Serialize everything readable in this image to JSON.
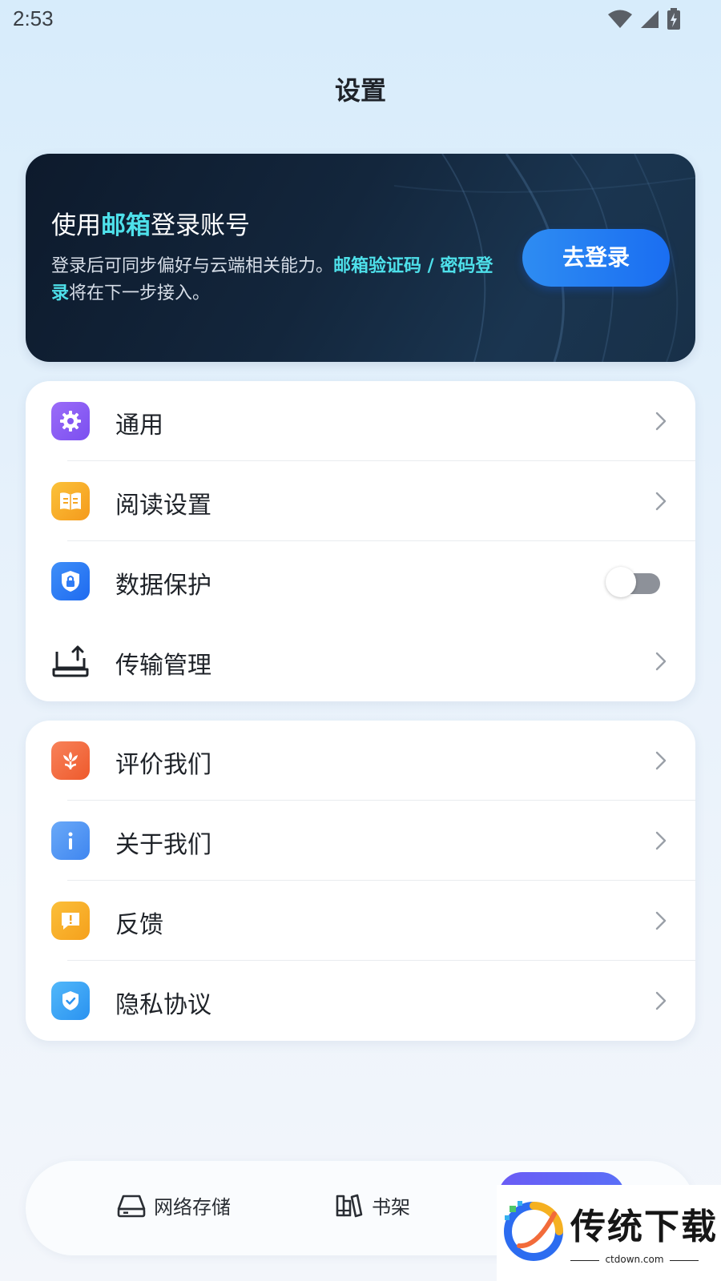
{
  "status_bar": {
    "time": "2:53"
  },
  "header": {
    "title": "设置"
  },
  "login_banner": {
    "heading_prefix": "使用",
    "heading_highlight": "邮箱",
    "heading_suffix": "登录账号",
    "desc_plain_1": "登录后可同步偏好与云端相关能力。",
    "desc_highlight": "邮箱验证码 / 密码登录",
    "desc_plain_2": "将在下一步接入。",
    "button_label": "去登录"
  },
  "settings_group_1": {
    "items": [
      {
        "label": "通用",
        "icon": "gear-icon",
        "color": "#8b5cf6"
      },
      {
        "label": "阅读设置",
        "icon": "book-icon",
        "color": "#f5a623"
      },
      {
        "label": "数据保护",
        "icon": "shield-lock-icon",
        "color": "#2f7cf6",
        "toggle_on": false
      },
      {
        "label": "传输管理",
        "icon": "laptop-upload-icon"
      }
    ]
  },
  "settings_group_2": {
    "items": [
      {
        "label": "评价我们",
        "icon": "flower-icon",
        "color": "#f26b3a"
      },
      {
        "label": "关于我们",
        "icon": "info-icon",
        "color": "#4a90f5"
      },
      {
        "label": "反馈",
        "icon": "feedback-icon",
        "color": "#f5a623"
      },
      {
        "label": "隐私协议",
        "icon": "privacy-shield-icon",
        "color": "#3aa0f5"
      }
    ]
  },
  "bottom_nav": {
    "items": [
      {
        "label": "网络存储",
        "icon": "storage-icon"
      },
      {
        "label": "书架",
        "icon": "bookshelf-icon"
      }
    ]
  },
  "watermark": {
    "brand": "传统下载",
    "url": "ctdown.com"
  }
}
